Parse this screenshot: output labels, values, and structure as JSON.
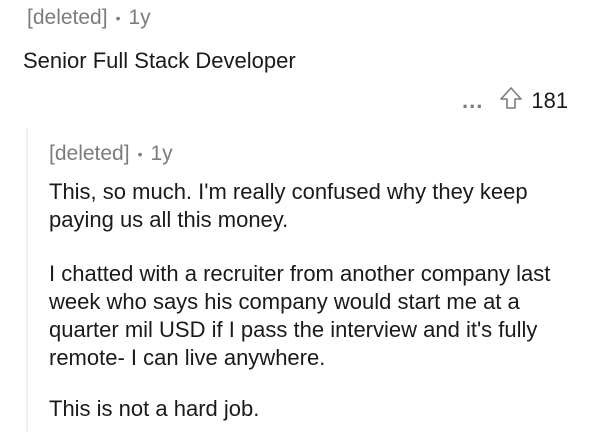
{
  "top_comment": {
    "author": "[deleted]",
    "separator": "•",
    "age": "1y",
    "text": "Senior Full Stack Developer",
    "more_label": "...",
    "votes": "181"
  },
  "reply": {
    "author": "[deleted]",
    "separator": "•",
    "age": "1y",
    "paragraphs": [
      "This, so much. I'm really confused why they keep paying us all this money.",
      "I chatted with a recruiter from another company last week who says his company would start me at a quarter mil USD if I pass the interview and it's fully remote- I can live anywhere.",
      "This is not a hard job."
    ]
  },
  "colors": {
    "meta": "#7c7c7c",
    "text": "#1a1a1b",
    "thread_line": "#edeff1"
  }
}
